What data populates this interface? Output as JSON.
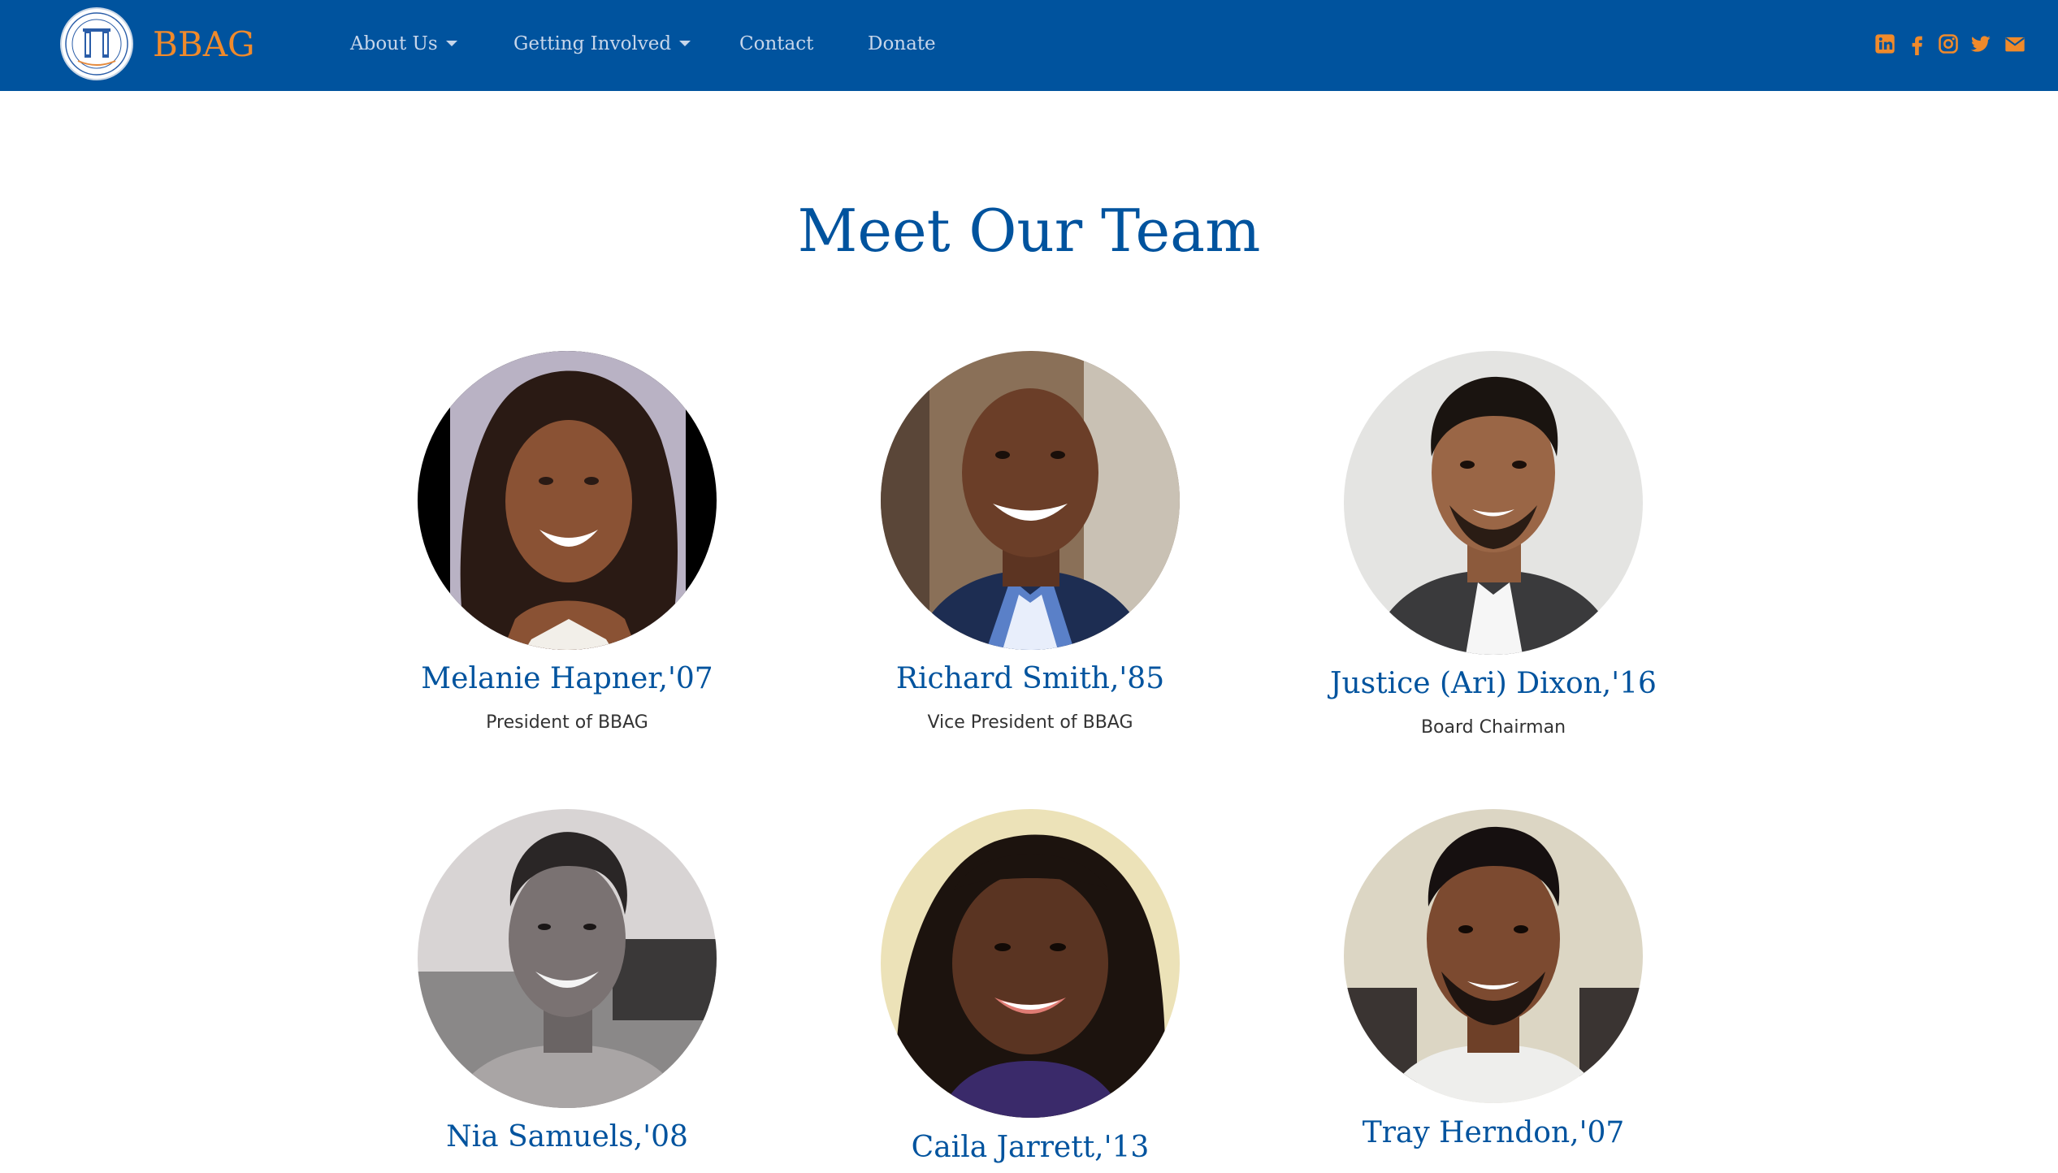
{
  "nav": {
    "brand": "BBAG",
    "logo": "bbag-logo-seal",
    "items": [
      {
        "label": "About Us",
        "dropdown": true
      },
      {
        "label": "Getting Involved",
        "dropdown": true
      },
      {
        "label": "Contact",
        "dropdown": false
      },
      {
        "label": "Donate",
        "dropdown": false
      }
    ],
    "social_icons": [
      "linkedin-icon",
      "facebook-icon",
      "instagram-icon",
      "twitter-icon",
      "envelope-icon"
    ]
  },
  "page": {
    "title": "Meet Our Team"
  },
  "team": [
    {
      "name": "Melanie Hapner,'07",
      "role": "President of BBAG"
    },
    {
      "name": "Richard Smith,'85",
      "role": "Vice President of BBAG"
    },
    {
      "name": "Justice (Ari) Dixon,'16",
      "role": "Board Chairman"
    },
    {
      "name": "Nia Samuels,'08",
      "role": ""
    },
    {
      "name": "Caila Jarrett,'13",
      "role": ""
    },
    {
      "name": "Tray Herndon,'07",
      "role": ""
    }
  ],
  "colors": {
    "navbar": "#00539e",
    "brand": "#f08a2b",
    "nav_text": "#c7d6ea",
    "heading": "#00539e",
    "social_icons": "#f08a2b"
  }
}
